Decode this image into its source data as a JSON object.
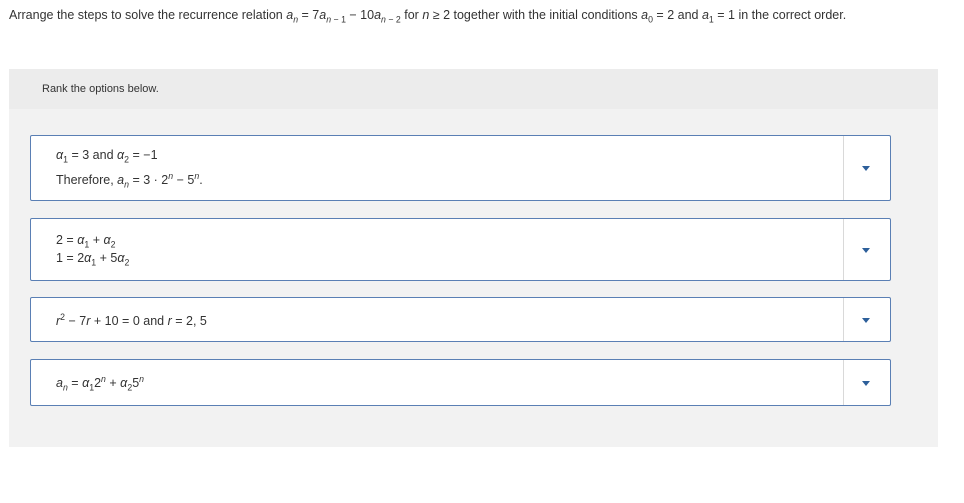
{
  "question": {
    "prefix": "Arrange the steps to solve the recurrence relation ",
    "relation": "a",
    "suffix": " for n ≥ 2 together with the initial conditions a0 = 2 and a1 = 1 in the correct order."
  },
  "question_text": {
    "p1": "Arrange the steps to solve the recurrence relation ",
    "p2": " for ",
    "p3": " together with the initial conditions ",
    "p4": " and ",
    "p5": " in the correct order."
  },
  "panel": {
    "header_label": "Rank the options below."
  },
  "options": [
    {
      "line1": "α1 = 3 and α2 = −1",
      "line2": "Therefore, an = 3 · 2n − 5n."
    },
    {
      "line1": "2 = α1 + α2",
      "line2": "1 = 2α1 + 5α2"
    },
    {
      "line1": "r2 − 7r + 10 = 0 and r = 2, 5"
    },
    {
      "line1": "an = α12n + α25n"
    }
  ],
  "icons": {
    "dropdown": "caret-down-icon"
  },
  "colors": {
    "option_border": "#5a7fb4",
    "caret": "#2d5f9a",
    "panel_bg": "#f2f2f2"
  }
}
